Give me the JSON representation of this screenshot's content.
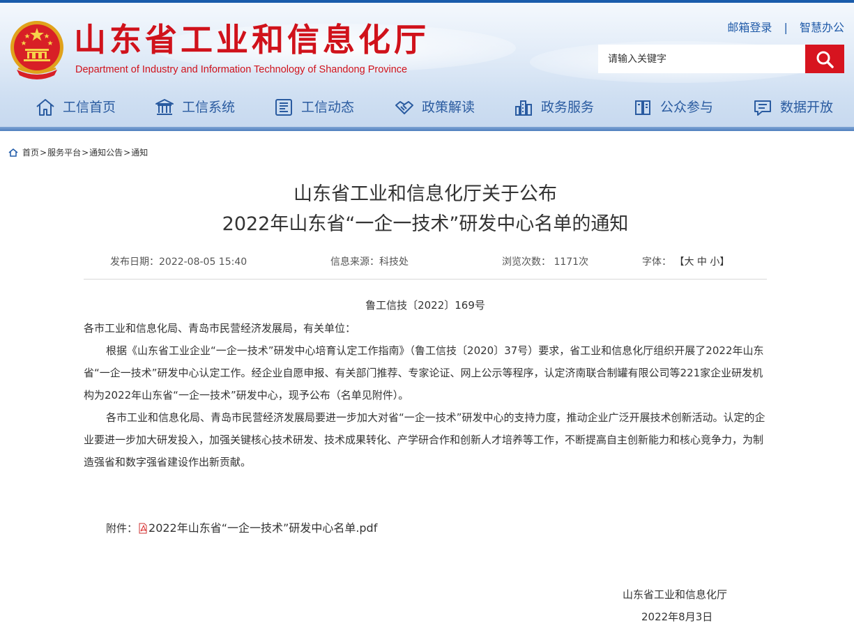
{
  "header": {
    "site_title": "山东省工业和信息化厅",
    "site_subtitle": "Department of Industry and Information Technology of Shandong Province",
    "top_links": [
      "邮箱登录",
      "智慧办公"
    ],
    "search_placeholder": "请输入关键字",
    "accent_color": "#d0121b"
  },
  "nav": {
    "items": [
      {
        "label": "工信首页",
        "icon": "home-icon"
      },
      {
        "label": "工信系统",
        "icon": "institution-icon"
      },
      {
        "label": "工信动态",
        "icon": "news-icon"
      },
      {
        "label": "政策解读",
        "icon": "handshake-icon"
      },
      {
        "label": "政务服务",
        "icon": "city-icon"
      },
      {
        "label": "公众参与",
        "icon": "book-icon"
      },
      {
        "label": "数据开放",
        "icon": "message-icon"
      }
    ]
  },
  "breadcrumb": [
    "首页",
    "服务平台",
    "通知公告",
    "通知"
  ],
  "article": {
    "title_line1": "山东省工业和信息化厅关于公布",
    "title_line2": "2022年山东省“一企一技术”研发中心名单的通知",
    "publish_date": "发布日期：2022-08-05 15:40",
    "source": "信息来源：科技处",
    "views": "浏览次数： 1171次",
    "font_label": "字体：",
    "font_sizes": [
      "大",
      "中",
      "小"
    ],
    "doc_number": "鲁工信技〔2022〕169号",
    "recipients": "各市工业和信息化局、青岛市民营经济发展局，有关单位：",
    "para1": "根据《山东省工业企业“一企一技术”研发中心培育认定工作指南》（鲁工信技〔2020〕37号）要求，省工业和信息化厅组织开展了2022年山东省“一企一技术”研发中心认定工作。经企业自愿申报、有关部门推荐、专家论证、网上公示等程序，认定济南联合制罐有限公司等221家企业研发机构为2022年山东省“一企一技术”研发中心，现予公布（名单见附件）。",
    "para2": "各市工业和信息化局、青岛市民营经济发展局要进一步加大对省“一企一技术”研发中心的支持力度，推动企业广泛开展技术创新活动。认定的企业要进一步加大研发投入，加强关键核心技术研发、技术成果转化、产学研合作和创新人才培养等工作，不断提高自主创新能力和核心竞争力，为制造强省和数字强省建设作出新贡献。",
    "attachment_label": "附件：",
    "attachment_name": "2022年山东省“一企一技术”研发中心名单.pdf",
    "signature_org": "山东省工业和信息化厅",
    "signature_date": "2022年8月3日"
  }
}
